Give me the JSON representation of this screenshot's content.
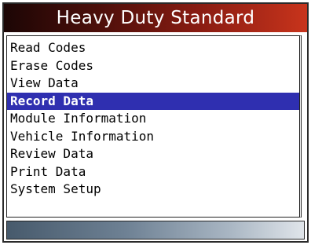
{
  "header": {
    "title": "Heavy Duty Standard"
  },
  "menu": {
    "selected_index": 3,
    "items": [
      {
        "label": "Read Codes"
      },
      {
        "label": "Erase Codes"
      },
      {
        "label": "View Data"
      },
      {
        "label": "Record Data"
      },
      {
        "label": "Module Information"
      },
      {
        "label": "Vehicle Information"
      },
      {
        "label": "Review Data"
      },
      {
        "label": "Print Data"
      },
      {
        "label": "System Setup"
      }
    ]
  },
  "colors": {
    "title_gradient_start": "#1c0605",
    "title_gradient_end": "#c8341c",
    "selection_highlight": "#2f2fb0",
    "status_gradient_start": "#475a6c",
    "status_gradient_end": "#e0e5ea"
  }
}
